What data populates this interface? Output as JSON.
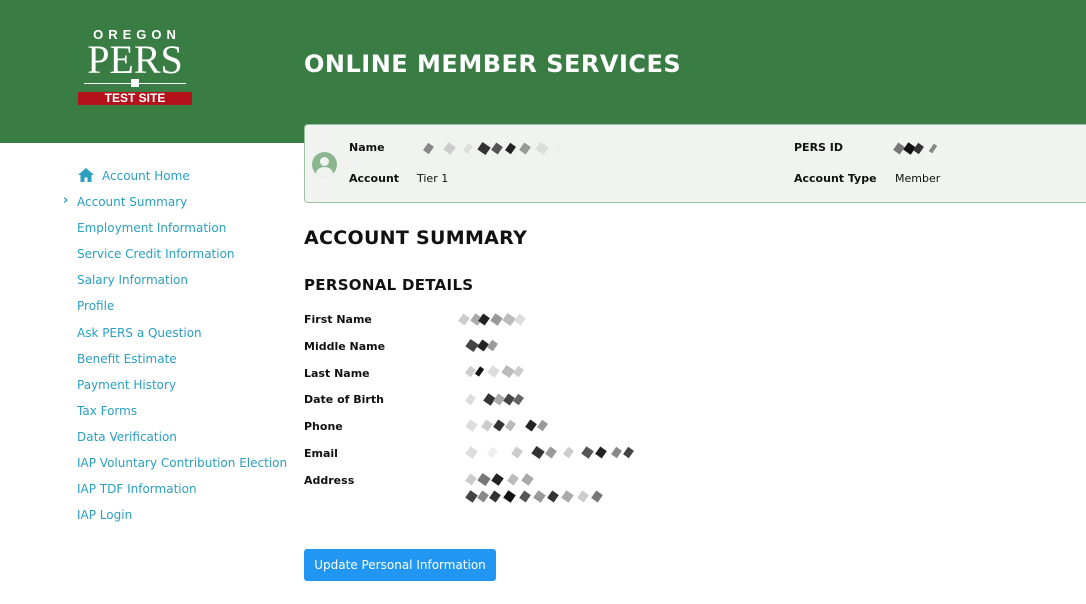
{
  "header": {
    "logo": {
      "top_text": "OREGON",
      "main_text": "PERS",
      "badge": "TEST SITE"
    },
    "title": "ONLINE MEMBER SERVICES"
  },
  "member_card": {
    "name_label": "Name",
    "account_label": "Account",
    "account_value": "Tier 1",
    "pers_id_label": "PERS ID",
    "account_type_label": "Account Type",
    "account_type_value": "Member"
  },
  "sidebar": {
    "items": [
      {
        "label": "Account Home",
        "icon": "home-icon"
      },
      {
        "label": "Account Summary",
        "current": true
      },
      {
        "label": "Employment Information"
      },
      {
        "label": "Service Credit Information"
      },
      {
        "label": "Salary Information"
      },
      {
        "label": "Profile"
      },
      {
        "label": "Ask PERS a Question"
      },
      {
        "label": "Benefit Estimate"
      },
      {
        "label": "Payment History"
      },
      {
        "label": "Tax Forms"
      },
      {
        "label": "Data Verification"
      },
      {
        "label": "IAP Voluntary Contribution Election"
      },
      {
        "label": "IAP TDF Information"
      },
      {
        "label": "IAP Login"
      }
    ]
  },
  "main": {
    "title": "ACCOUNT SUMMARY",
    "section_title": "PERSONAL DETAILS",
    "fields": [
      {
        "label": "First Name"
      },
      {
        "label": "Middle Name"
      },
      {
        "label": "Last Name"
      },
      {
        "label": "Date of Birth"
      },
      {
        "label": "Phone"
      },
      {
        "label": "Email"
      },
      {
        "label": "Address"
      }
    ],
    "update_button": "Update Personal Information"
  },
  "colors": {
    "header_green": "#3a7d44",
    "test_site_red": "#b3121b",
    "link_blue": "#2a9fc0",
    "button_blue": "#2196f3"
  }
}
